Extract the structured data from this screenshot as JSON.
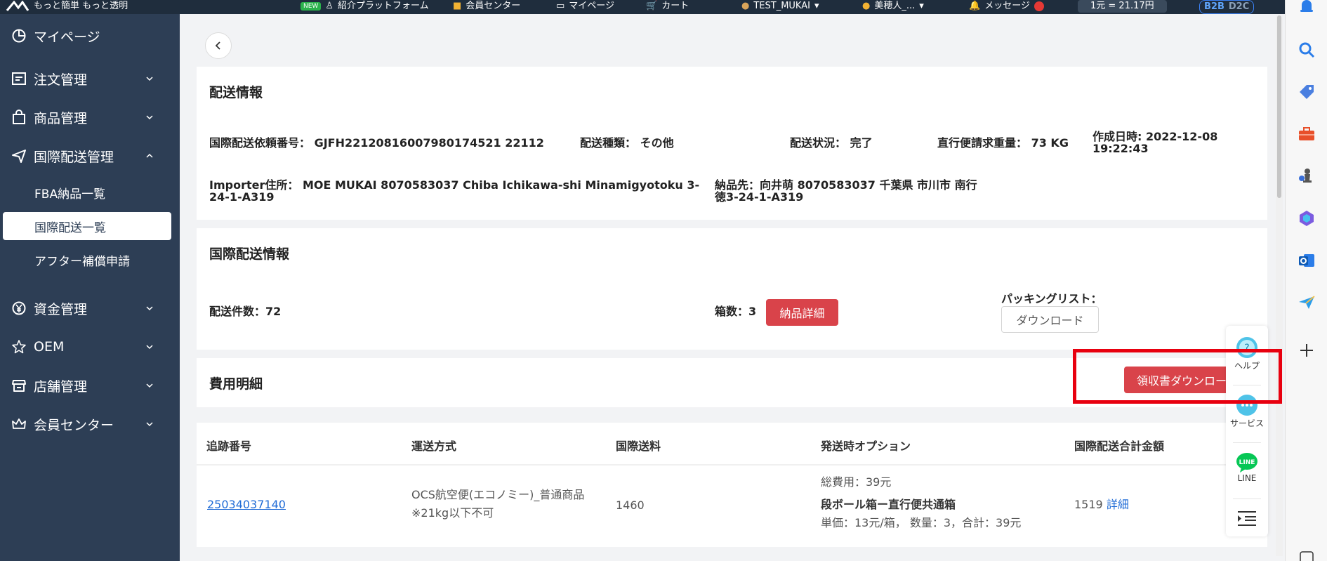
{
  "topbar": {
    "brand": "もっと簡単 もっと透明",
    "new_badge": "NEW",
    "invite": "紹介プラットフォーム",
    "member_center": "会員センター",
    "mypage": "マイページ",
    "cart": "カート",
    "user": "TEST_MUKAI",
    "staff": "美穂人_...",
    "messages": "メッセージ",
    "rate": "1元 = 21.17円",
    "b2b": "B2B",
    "d2c": "D2C"
  },
  "sidebar": {
    "items": [
      {
        "label": "マイページ",
        "icon": "clock-icon"
      },
      {
        "label": "注文管理",
        "icon": "order-icon"
      },
      {
        "label": "商品管理",
        "icon": "bag-icon"
      },
      {
        "label": "国際配送管理",
        "icon": "plane-icon"
      },
      {
        "label": "資金管理",
        "icon": "yen-icon"
      },
      {
        "label": "OEM",
        "icon": "oem-icon"
      },
      {
        "label": "店舗管理",
        "icon": "store-icon"
      },
      {
        "label": "会員センター",
        "icon": "crown-icon"
      }
    ],
    "sub_items": [
      {
        "label": "FBA納品一覧"
      },
      {
        "label": "国際配送一覧"
      },
      {
        "label": "アフター補償申請"
      }
    ]
  },
  "shipping_info": {
    "title": "配送情報",
    "request_no_label": "国際配送依頼番号：",
    "request_no": "GJFH22120816007980174521 22112",
    "type_label": "配送種類：",
    "type": "その他",
    "status_label": "配送状況：",
    "status": "完了",
    "weight_label": "直行便請求重量：",
    "weight": "73 KG",
    "created_label": "作成日時:",
    "created_date": "2022-12-08",
    "created_time": "19:22:43",
    "importer_label": "Importer住所：",
    "importer_line1": "MOE MUKAI 8070583037 Chiba Ichikawa-shi Minamigyotoku 3-",
    "importer_line2": "24-1-A319",
    "dest_label": "納品先：",
    "dest_line1": "向井萌 8070583037 千葉県 市川市 南行",
    "dest_line2": "徳3-24-1-A319"
  },
  "intl_info": {
    "title": "国際配送情報",
    "count_label": "配送件数：",
    "count": "72",
    "boxes_label": "箱数：",
    "boxes": "3",
    "detail_button": "納品詳細",
    "packing_label": "パッキングリスト：",
    "download_button": "ダウンロード"
  },
  "fees": {
    "title": "費用明細",
    "receipt_button": "領収書ダウンロード"
  },
  "table": {
    "headers": [
      "追跡番号",
      "運送方式",
      "国際送料",
      "発送時オプション",
      "国際配送合計金額"
    ],
    "row": {
      "tracking": "25034037140",
      "method_line1": "OCS航空便(エコノミー)_普通商品",
      "method_line2": "※21kg以下不可",
      "shipping_fee": "1460",
      "option_total": "総費用：39元",
      "option_name": "段ボール箱ー直行便共通箱",
      "option_detail": "単価：13元/箱， 数量：3，合計：39元",
      "grand_total": "1519",
      "detail_link": "詳細"
    }
  },
  "float_panel": {
    "help": "ヘルプ",
    "service": "サービス",
    "line_badge": "LINE",
    "line": "LINE"
  },
  "colors": {
    "sidebar": "#2d3e55",
    "accent_red": "#d9434a",
    "link": "#1f6bd6",
    "highlight": "#e8000f"
  }
}
